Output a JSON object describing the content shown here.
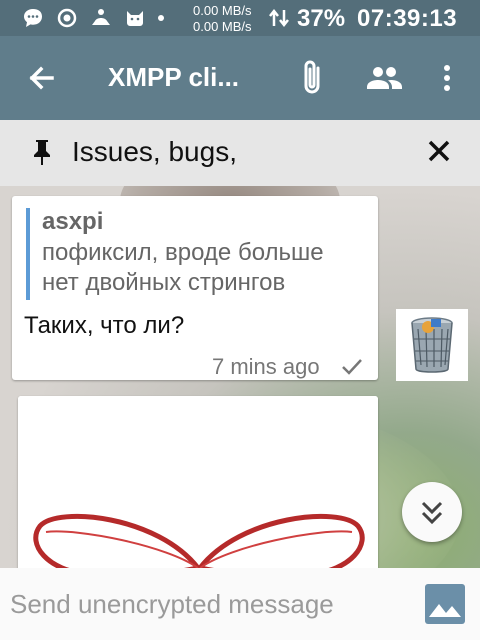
{
  "status_bar": {
    "net_up": "0.00 MB/s",
    "net_down": "0.00 MB/s",
    "battery": "37%",
    "time": "07:39:13"
  },
  "toolbar": {
    "title": "XMPP cli..."
  },
  "pinned": {
    "text": "Issues, bugs,"
  },
  "message": {
    "quote_author": "asxpi",
    "quote_line1": "пофиксил, вроде больше",
    "quote_line2": "нет двойных стрингов",
    "body": "Таких, что ли?",
    "time": "7 mins ago"
  },
  "composer": {
    "placeholder": "Send unencrypted message"
  },
  "colors": {
    "status_bar": "#546e7a",
    "toolbar": "#607d8b",
    "quote_bar": "#5c9bd6"
  }
}
